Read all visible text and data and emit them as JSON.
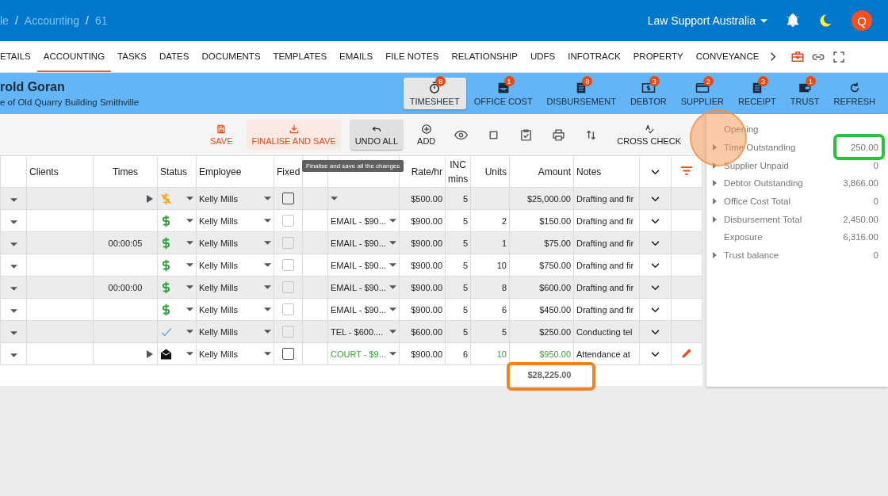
{
  "breadcrumb": [
    "le",
    "Accounting",
    "61"
  ],
  "breadcrumb_separator": "/",
  "account": "Law Support Australia",
  "avatar": "Q",
  "tabs": [
    {
      "label": "ETAILS",
      "selected": false
    },
    {
      "label": "ACCOUNTING",
      "selected": true
    },
    {
      "label": "TASKS",
      "selected": false
    },
    {
      "label": "DATES",
      "selected": false
    },
    {
      "label": "DOCUMENTS",
      "selected": false
    },
    {
      "label": "TEMPLATES",
      "selected": false
    },
    {
      "label": "EMAILS",
      "selected": false
    },
    {
      "label": "FILE NOTES",
      "selected": false
    },
    {
      "label": "RELATIONSHIP",
      "selected": false
    },
    {
      "label": "UDFS",
      "selected": false
    },
    {
      "label": "INFOTRACK",
      "selected": false
    },
    {
      "label": "PROPERTY",
      "selected": false
    },
    {
      "label": "CONVEYANCE",
      "selected": false
    }
  ],
  "matter": {
    "title": "rold Goran",
    "subtitle": "e of Old Quarry Building Smithville"
  },
  "ledger_buttons": [
    {
      "label": "TIMESHEET",
      "badge": "8",
      "kind": "timer",
      "selected": true
    },
    {
      "label": "OFFICE COST",
      "badge": "1",
      "kind": "tray",
      "selected": false
    },
    {
      "label": "DISBURSEMENT",
      "badge": "8",
      "kind": "receipt",
      "selected": false
    },
    {
      "label": "DEBTOR",
      "badge": "3",
      "kind": "money",
      "selected": false
    },
    {
      "label": "SUPPLIER",
      "badge": "2",
      "kind": "card",
      "selected": false
    },
    {
      "label": "RECEIPT",
      "badge": "3",
      "kind": "receipt",
      "selected": false
    },
    {
      "label": "TRUST",
      "badge": "1",
      "kind": "wallet",
      "selected": false
    },
    {
      "label": "REFRESH",
      "kind": "refresh",
      "selected": false
    }
  ],
  "toolbar": [
    {
      "label": "SAVE",
      "kind": "save"
    },
    {
      "label": "FINALISE AND SAVE",
      "kind": "finalise"
    },
    {
      "label": "UNDO ALL",
      "kind": "undo"
    },
    {
      "label": "ADD",
      "kind": "add"
    },
    {
      "kind": "view"
    },
    {
      "kind": "square"
    },
    {
      "kind": "checklist"
    },
    {
      "kind": "print"
    },
    {
      "kind": "sort"
    },
    {
      "label": "CROSS CHECK",
      "kind": "spell"
    }
  ],
  "tooltip": "Finalise and save all the changes",
  "table": {
    "headers": {
      "clients": "Clients",
      "times": "Times",
      "status": "Status",
      "employee": "Employee",
      "fixed": "Fixed",
      "rate": "Rate/hr",
      "inc": "INC mins",
      "units": "Units",
      "amount": "Amount",
      "notes": "Notes"
    },
    "rows": [
      {
        "play": true,
        "kind": "pending",
        "employee": "Kelly Mills",
        "fixed": {
          "checked": false,
          "disabled": false
        },
        "rate": "$500.00",
        "inc": "5",
        "amount": "$25,000.00",
        "notes": "Drafting and fir",
        "editing": false
      },
      {
        "play": false,
        "kind": "billed",
        "employee": "Kelly Mills",
        "fixed": {
          "checked": false,
          "disabled": true
        },
        "rate_item": "EMAIL - $90...",
        "rate": "$900.00",
        "inc": "5",
        "units": "2",
        "amount": "$150.00",
        "notes": "Drafting and fir",
        "editing": false
      },
      {
        "times": "00:00:05",
        "play": false,
        "kind": "billed",
        "employee": "Kelly Mills",
        "fixed": {
          "checked": false,
          "disabled": true
        },
        "rate_item": "EMAIL - $90...",
        "rate": "$900.00",
        "inc": "5",
        "units": "1",
        "amount": "$75.00",
        "notes": "Drafting and fir",
        "editing": false
      },
      {
        "play": false,
        "kind": "billed",
        "employee": "Kelly Mills",
        "fixed": {
          "checked": false,
          "disabled": true
        },
        "rate_item": "EMAIL - $90...",
        "rate": "$900.00",
        "inc": "5",
        "units": "10",
        "amount": "$750.00",
        "notes": "Drafting and fir",
        "editing": false
      },
      {
        "times": "00:00:00",
        "play": false,
        "kind": "billed",
        "employee": "Kelly Mills",
        "fixed": {
          "checked": false,
          "disabled": true
        },
        "rate_item": "EMAIL - $90...",
        "rate": "$900.00",
        "inc": "5",
        "units": "8",
        "amount": "$600.00",
        "notes": "Drafting and fir",
        "editing": false
      },
      {
        "play": false,
        "kind": "billed",
        "employee": "Kelly Mills",
        "fixed": {
          "checked": false,
          "disabled": true
        },
        "rate_item": "EMAIL - $90...",
        "rate": "$900.00",
        "inc": "5",
        "units": "6",
        "amount": "$450.00",
        "notes": "Drafting and fir",
        "editing": false
      },
      {
        "play": false,
        "kind": "done",
        "employee": "Kelly Mills",
        "fixed": {
          "checked": false,
          "disabled": true
        },
        "rate_item": "TEL - $600....",
        "rate": "$600.00",
        "inc": "5",
        "units": "5",
        "amount": "$250.00",
        "notes": "Conducting tel",
        "editing": false
      },
      {
        "play": true,
        "kind": "mail",
        "employee": "Kelly Mills",
        "fixed": {
          "checked": false,
          "disabled": false
        },
        "rate_item": "COURT - $9...",
        "rate": "$900.00",
        "inc": "6",
        "units": "10",
        "amount": "$950.00",
        "notes": "Attendance at",
        "editing": true
      }
    ],
    "total": "$28,225.00",
    "total_highlighted": true
  },
  "summary": [
    {
      "label": "Opening",
      "kind": "plain",
      "highlighted": false
    },
    {
      "label": "Time Outstanding",
      "value": "250.00",
      "kind": "group",
      "highlighted": true
    },
    {
      "label": "Supplier Unpaid",
      "value": "0",
      "kind": "group",
      "highlighted": false
    },
    {
      "label": "Debtor Outstanding",
      "value": "3,866.00",
      "kind": "group",
      "highlighted": false
    },
    {
      "label": "Office Cost Total",
      "value": "0",
      "kind": "group",
      "highlighted": false
    },
    {
      "label": "Disbursement Total",
      "value": "2,450.00",
      "kind": "group",
      "highlighted": false
    },
    {
      "label": "Exposure",
      "value": "6,316.00",
      "kind": "plain",
      "highlighted": false
    },
    {
      "label": "Trust balance",
      "value": "0",
      "kind": "group",
      "highlighted": false
    }
  ],
  "click_marker": true
}
